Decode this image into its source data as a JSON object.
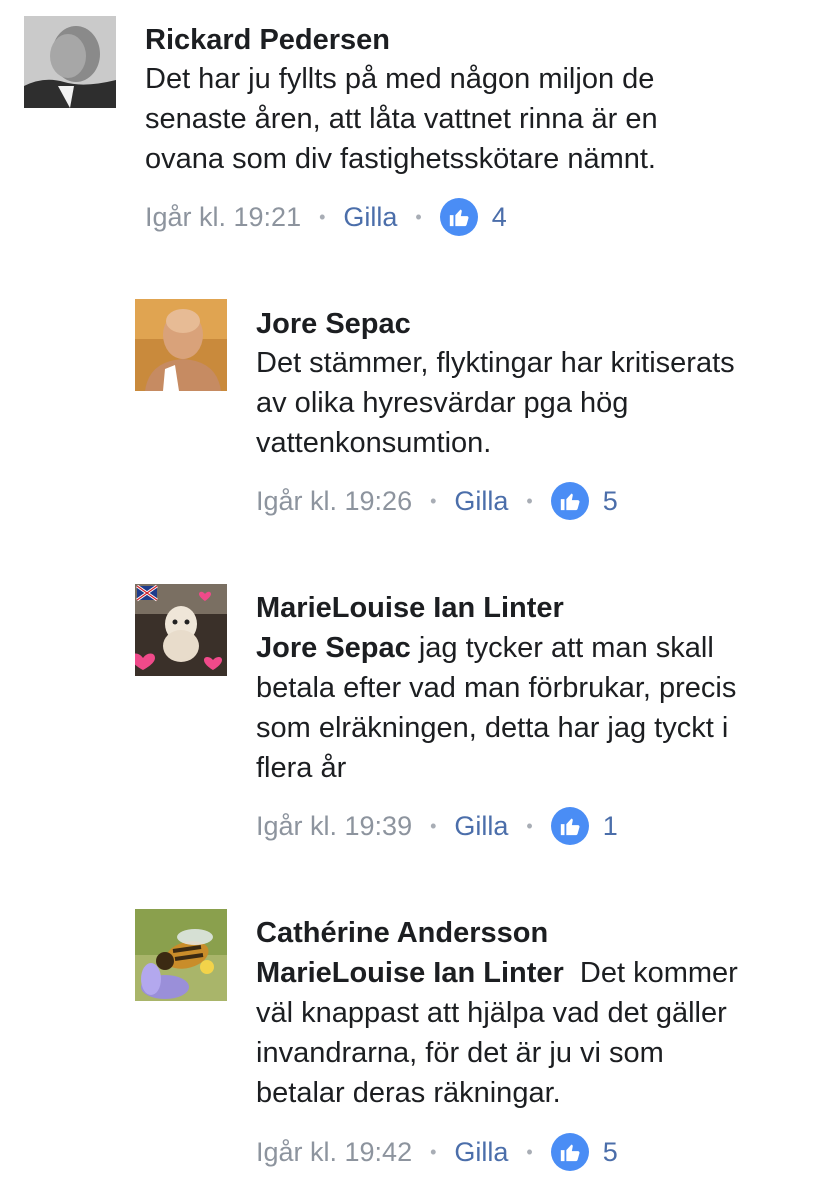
{
  "comments": [
    {
      "author": "Rickard Pedersen",
      "lines": [
        {
          "mention": "",
          "text": "Det har ju fyllts på med någon miljon de"
        },
        {
          "mention": "",
          "text": "senaste åren, att låta vattnet rinna är en"
        },
        {
          "mention": "",
          "text": "ovana som div fastighetsskötare nämnt."
        }
      ],
      "time": "Igår kl. 19:21",
      "like_label": "Gilla",
      "reaction_count": "4"
    },
    {
      "author": "Jore Sepac",
      "lines": [
        {
          "mention": "",
          "text": "Det stämmer, flyktingar har kritiserats"
        },
        {
          "mention": "",
          "text": "av olika hyresvärdar pga hög"
        },
        {
          "mention": "",
          "text": "vattenkonsumtion."
        }
      ],
      "time": "Igår kl. 19:26",
      "like_label": "Gilla",
      "reaction_count": "5"
    },
    {
      "author": "MarieLouise Ian Linter",
      "lines": [
        {
          "mention": "Jore Sepac",
          "text": " jag tycker att man skall"
        },
        {
          "mention": "",
          "text": "betala efter vad man förbrukar, precis"
        },
        {
          "mention": "",
          "text": "som elräkningen, detta har jag tyckt i"
        },
        {
          "mention": "",
          "text": "flera år"
        }
      ],
      "time": "Igår kl. 19:39",
      "like_label": "Gilla",
      "reaction_count": "1"
    },
    {
      "author": "Cathérine Andersson",
      "lines": [
        {
          "mention": "MarieLouise Ian Linter",
          "text": "  Det kommer"
        },
        {
          "mention": "",
          "text": "väl knappast att hjälpa vad det gäller"
        },
        {
          "mention": "",
          "text": "invandrarna, för det är ju vi som"
        },
        {
          "mention": "",
          "text": "betalar deras räkningar."
        }
      ],
      "time": "Igår kl. 19:42",
      "like_label": "Gilla",
      "reaction_count": "5"
    }
  ],
  "icons": {
    "separator": "•",
    "reaction": "thumbs-up-icon"
  },
  "colors": {
    "like_blue": "#4a8df5",
    "link_blue": "#4b6eaa",
    "meta_gray": "#8d949e",
    "text_dark": "#1c1e21"
  }
}
